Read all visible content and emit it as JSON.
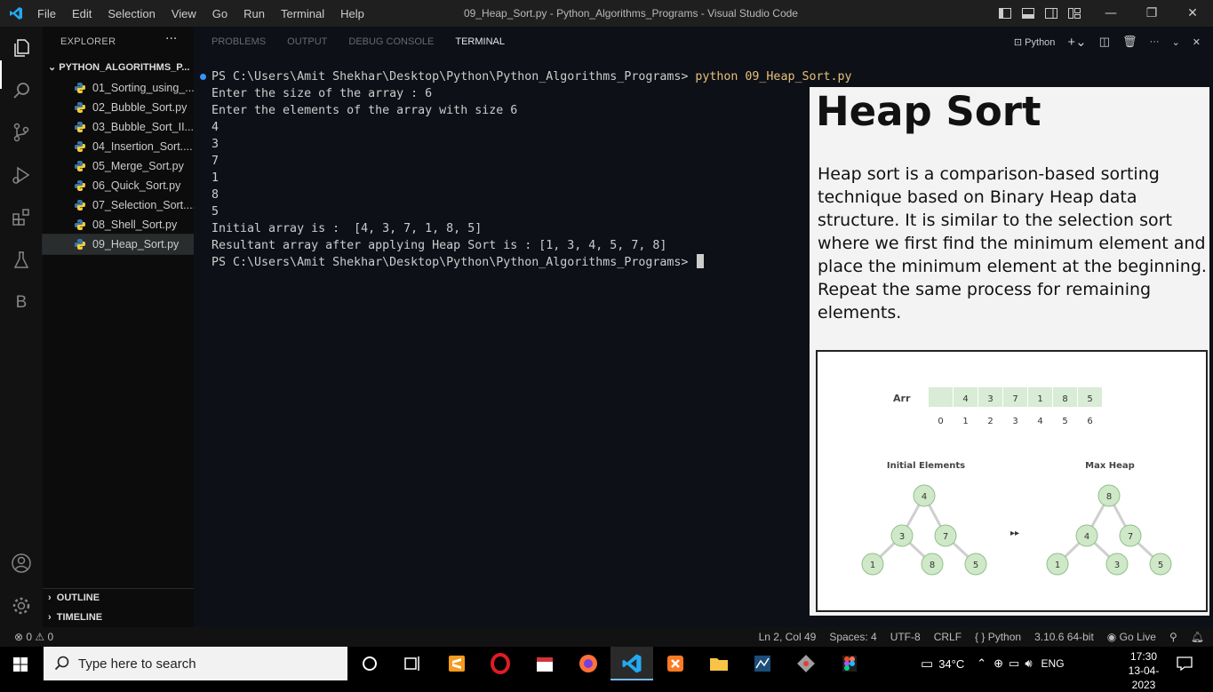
{
  "titlebar": {
    "menus": [
      "File",
      "Edit",
      "Selection",
      "View",
      "Go",
      "Run",
      "Terminal",
      "Help"
    ],
    "window_title": "09_Heap_Sort.py - Python_Algorithms_Programs - Visual Studio Code"
  },
  "explorer": {
    "header": "EXPLORER",
    "more": "···",
    "folder": "PYTHON_ALGORITHMS_P...",
    "files": [
      "01_Sorting_using_...",
      "02_Bubble_Sort.py",
      "03_Bubble_Sort_II....",
      "04_Insertion_Sort....",
      "05_Merge_Sort.py",
      "06_Quick_Sort.py",
      "07_Selection_Sort....",
      "08_Shell_Sort.py",
      "09_Heap_Sort.py"
    ],
    "selected_index": 8,
    "outline": "OUTLINE",
    "timeline": "TIMELINE"
  },
  "panel": {
    "tabs": [
      "PROBLEMS",
      "OUTPUT",
      "DEBUG CONSOLE",
      "TERMINAL"
    ],
    "active_tab": "TERMINAL",
    "shell_label": "Python"
  },
  "terminal": {
    "prompt": "PS C:\\Users\\Amit Shekhar\\Desktop\\Python\\Python_Algorithms_Programs> ",
    "command": "python 09_Heap_Sort.py",
    "lines": [
      "Enter the size of the array : 6",
      "Enter the elements of the array with size 6",
      "4",
      "3",
      "7",
      "1",
      "8",
      "5",
      "Initial array is :  [4, 3, 7, 1, 8, 5]",
      "Resultant array after applying Heap Sort is : [1, 3, 4, 5, 7, 8]"
    ],
    "final_prompt": "PS C:\\Users\\Amit Shekhar\\Desktop\\Python\\Python_Algorithms_Programs> "
  },
  "overlay": {
    "title": "Heap Sort",
    "description": "Heap sort is a comparison-based sorting technique based on Binary Heap data structure. It  is similar to the selection sort where we first find the minimum element and place the minimum element at the beginning. Repeat the same process for remaining elements.",
    "diagram": {
      "arr_label": "Arr",
      "arr_values": [
        "",
        "4",
        "3",
        "7",
        "1",
        "8",
        "5"
      ],
      "indices": [
        "0",
        "1",
        "2",
        "3",
        "4",
        "5",
        "6"
      ],
      "left_label": "Initial Elements",
      "right_label": "Max Heap",
      "arrow": "▸▸",
      "initial_tree": [
        "4",
        "3",
        "7",
        "1",
        "8",
        "5"
      ],
      "max_heap": [
        "8",
        "4",
        "7",
        "1",
        "3",
        "5"
      ]
    }
  },
  "statusbar": {
    "problems": "⊗ 0 ⚠ 0",
    "position": "Ln 2, Col 49",
    "spaces": "Spaces: 4",
    "encoding": "UTF-8",
    "eol": "CRLF",
    "language": "{ } Python",
    "interpreter": "3.10.6 64-bit",
    "golive": "Go Live"
  },
  "taskbar": {
    "search_placeholder": "Type here to search",
    "weather": "34°C",
    "lang": "ENG",
    "time": "17:30",
    "date": "13-04-2023"
  },
  "colors": {
    "accent_blue": "#3794ff",
    "node_fill": "#cfe8c8",
    "node_stroke": "#8fc08a",
    "vscode_blue": "#23a9f2"
  }
}
